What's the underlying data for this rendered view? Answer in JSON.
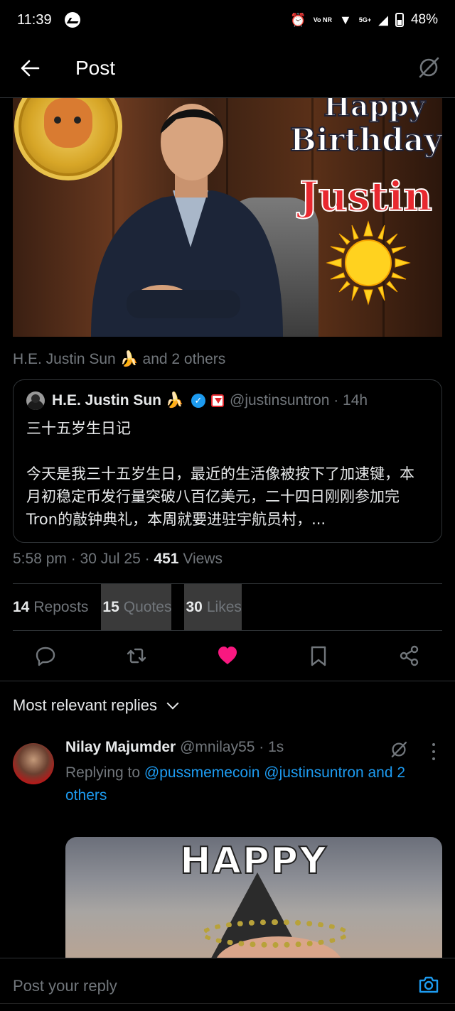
{
  "status_bar": {
    "time": "11:39",
    "network": "5G+",
    "volte": "Vo NR",
    "battery": "48%"
  },
  "header": {
    "title": "Post"
  },
  "post_image": {
    "text_happy": "Happy",
    "text_birthday": "Birthday",
    "text_justin": "Justin"
  },
  "liked_by": "H.E. Justin Sun 🍌 and 2 others",
  "quote": {
    "name": "H.E. Justin Sun 🍌",
    "handle": "@justinsuntron · 14h",
    "text_line1": "三十五岁生日记",
    "text_body": "今天是我三十五岁生日，最近的生活像被按下了加速键，本月初稳定币发行量突破八百亿美元，二十四日刚刚参加完Tron的敲钟典礼，本周就要进驻宇航员村，..."
  },
  "meta": {
    "time_date": "5:58 pm · 30 Jul 25 · ",
    "views_count": "451",
    "views_label": " Views"
  },
  "stats": {
    "reposts_count": "14",
    "reposts_label": "Reposts",
    "quotes_count": "15",
    "quotes_label": "Quotes",
    "likes_count": "30",
    "likes_label": "Likes"
  },
  "colors": {
    "accent": "#1d9bf0",
    "like": "#f91880",
    "muted": "#71767b",
    "text": "#e7e9ea",
    "background": "#000000",
    "border": "#2f3336"
  },
  "sort": {
    "label": "Most relevant replies"
  },
  "reply": {
    "name": "Nilay Majumder",
    "handle": "@mnilay55 · 1s",
    "replying_prefix": "Replying to ",
    "replying_targets": "@pussmemecoin @justinsuntron and 2 others",
    "media_text": "HAPPY"
  },
  "composer": {
    "placeholder": "Post your reply"
  },
  "icons": {
    "back": "back-arrow-icon",
    "grok": "grok-icon",
    "reply": "reply-icon",
    "repost": "repost-icon",
    "like": "heart-icon",
    "bookmark": "bookmark-icon",
    "share": "share-icon",
    "camera": "camera-icon",
    "more": "more-icon"
  }
}
